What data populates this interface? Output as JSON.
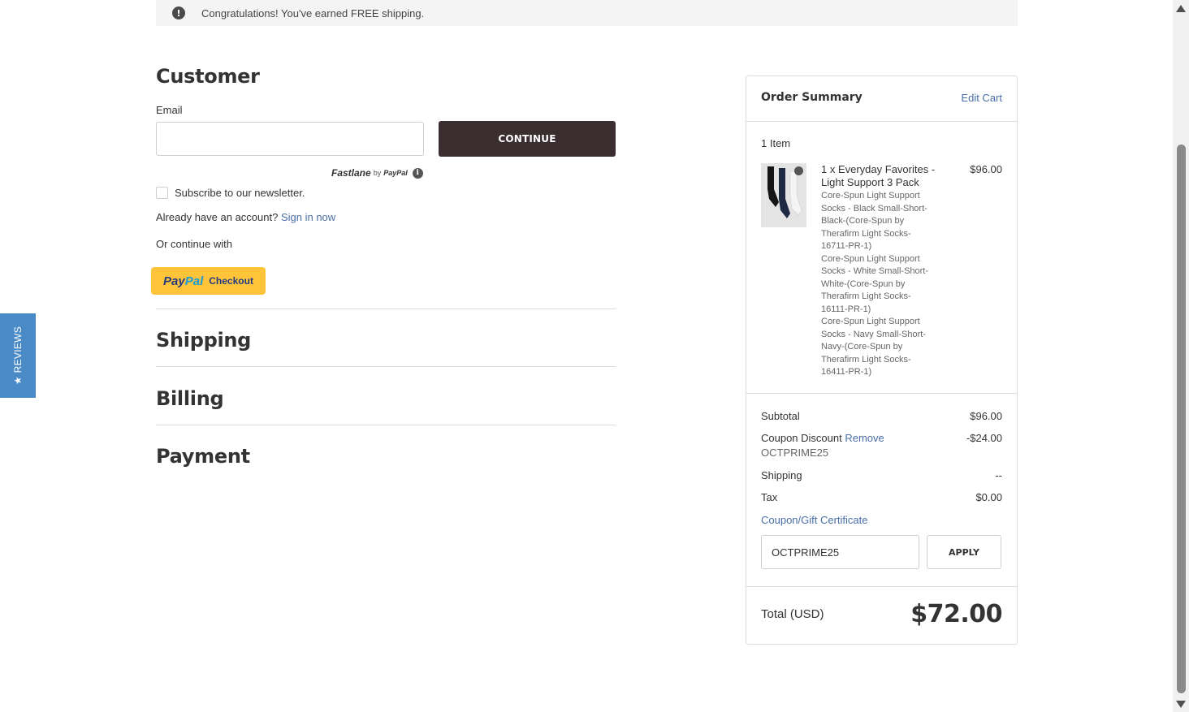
{
  "banner": {
    "icon": "exclamation-icon",
    "text": "Congratulations! You've earned FREE shipping."
  },
  "customer": {
    "title": "Customer",
    "email_label": "Email",
    "email_value": "",
    "continue_label": "CONTINUE",
    "fastlane_brand": "Fastlane",
    "fastlane_by": "by",
    "fastlane_paypal": "PayPal",
    "fastlane_info_icon": "i",
    "newsletter_label": "Subscribe to our newsletter.",
    "account_prompt": "Already have an account?",
    "sign_in_label": "Sign in now",
    "or_continue": "Or continue with",
    "paypal_pay": "Pay",
    "paypal_pal": "Pal",
    "paypal_checkout": "Checkout"
  },
  "steps": {
    "shipping": "Shipping",
    "billing": "Billing",
    "payment": "Payment"
  },
  "reviews_tab": {
    "label": "★ REVIEWS"
  },
  "summary": {
    "title": "Order Summary",
    "edit_cart": "Edit Cart",
    "items_count": "1 Item",
    "product": {
      "name": "1 x Everyday Favorites - Light Support 3 Pack",
      "price": "$96.00",
      "options": [
        "Core-Spun Light Support",
        "Socks - Black Small-Short-",
        "Black-(Core-Spun by",
        "Therafirm Light Socks-",
        "16711-PR-1)",
        "Core-Spun Light Support",
        "Socks - White Small-Short-",
        "White-(Core-Spun by",
        "Therafirm Light Socks-",
        "16111-PR-1)",
        "Core-Spun Light Support",
        "Socks - Navy Small-Short-",
        "Navy-(Core-Spun by",
        "Therafirm Light Socks-",
        "16411-PR-1)"
      ]
    },
    "subtotal_label": "Subtotal",
    "subtotal_value": "$96.00",
    "coupon_label": "Coupon Discount",
    "coupon_remove": "Remove",
    "coupon_code": "OCTPRIME25",
    "coupon_value": "-$24.00",
    "shipping_label": "Shipping",
    "shipping_value": "--",
    "tax_label": "Tax",
    "tax_value": "$0.00",
    "coupon_link": "Coupon/Gift Certificate",
    "coupon_input_value": "OCTPRIME25",
    "apply_label": "APPLY",
    "total_label": "Total (USD)",
    "total_value": "$72.00"
  },
  "colors": {
    "continue_button": "#3a2e30",
    "paypal_button": "#ffc439",
    "link": "#4a6ea8",
    "reviews_tab": "#4a8ac6"
  }
}
